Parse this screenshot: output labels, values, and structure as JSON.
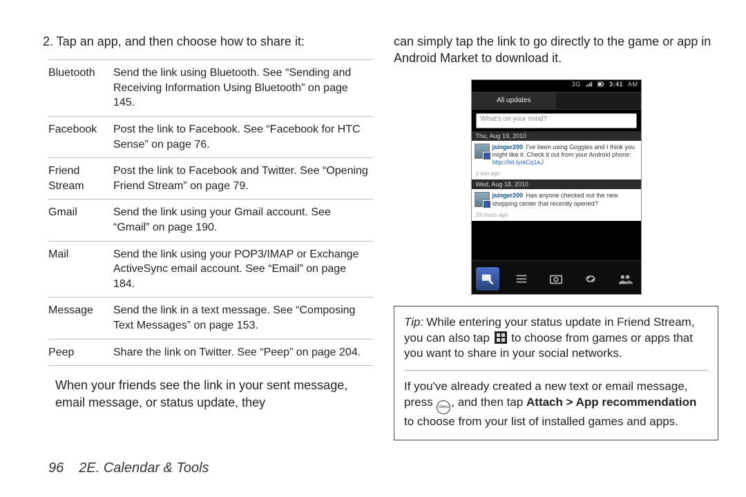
{
  "left": {
    "step": "2.  Tap an app, and then choose how to share it:",
    "rows": {
      "r0": {
        "k": "Bluetooth",
        "v": "Send the link using Bluetooth. See “Sending and Receiving Information Using Bluetooth” on page 145."
      },
      "r1": {
        "k": "Facebook",
        "v": "Post the link to Facebook. See “Facebook for HTC Sense” on page 76."
      },
      "r2": {
        "k": "Friend Stream",
        "v": "Post the link to Facebook and Twitter. See “Opening Friend Stream” on page 79."
      },
      "r3": {
        "k": "Gmail",
        "v": "Send the link using your Gmail account. See “Gmail” on page 190."
      },
      "r4": {
        "k": "Mail",
        "v": "Send the link using your POP3/IMAP or Exchange ActiveSync email account. See “Email” on page 184."
      },
      "r5": {
        "k": "Message",
        "v": "Send the link in a text message. See “Composing Text Messages” on page 153."
      },
      "r6": {
        "k": "Peep",
        "v": "Share the link on Twitter. See “Peep” on page 204."
      }
    },
    "after": "When your friends see the link in your sent message, email message, or status update, they"
  },
  "right": {
    "cont": "can simply tap the link to go directly to the game or app in Android Market to download it."
  },
  "phone": {
    "statusbar": {
      "net": "3G",
      "time": "3:41",
      "ampm": "AM"
    },
    "tab": "All updates",
    "placeholder": "What's on your mind?",
    "date1": "Thu, Aug 19, 2010",
    "post1": {
      "user": "jsinger200",
      "text": " I've been using Goggles and I think you might like it. Check it out from your Android phone:",
      "link": "http://bit.ly/aCq1eJ",
      "ts": "1 min ago"
    },
    "date2": "Wed, Aug 18, 2010",
    "post2": {
      "user": "jsinger200",
      "text": " Has anyone checked out the new shopping center that recently opened?",
      "ts": "19 hours ago"
    }
  },
  "tip": {
    "label": "Tip:",
    "p1a": "While entering your status update in Friend Stream, you can also tap ",
    "p1b": " to choose from games or apps that you want to share in your social networks.",
    "p2a": "If you've already created a new text or email message, press ",
    "p2b": ", and then tap ",
    "bold": "Attach > App recommendation",
    "p2c": " to choose from your list of installed games and apps."
  },
  "footer": {
    "page": "96",
    "section": "2E. Calendar & Tools"
  }
}
